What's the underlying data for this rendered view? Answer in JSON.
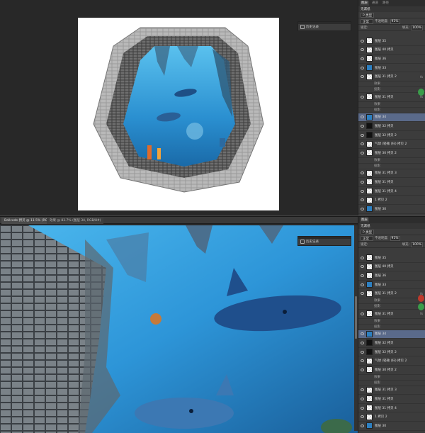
{
  "top": {
    "doc_tabs": [],
    "floating_panel_label": "历史记录",
    "layers_panel": {
      "tabs": [
        "图层",
        "通道",
        "路径"
      ],
      "subtitle": "无漏纸",
      "mode": "正常",
      "kind_filter": "P 类型",
      "opacity_label": "不透明度:",
      "opacity": "91%",
      "lock_label": "锁定:",
      "fill_label": "填充:",
      "fill": "100%",
      "layers": [
        {
          "name": "图层 35",
          "thumb": "checker"
        },
        {
          "name": "图层 40 拷贝",
          "thumb": "checker"
        },
        {
          "name": "图层 36",
          "thumb": "checker"
        },
        {
          "name": "图层 33",
          "thumb": "blue"
        },
        {
          "name": "图层 31 拷贝 2",
          "thumb": "checker",
          "fx": "fx"
        },
        {
          "name": "效果",
          "sub": true
        },
        {
          "name": "投影",
          "sub": true
        },
        {
          "name": "图层 31 拷贝",
          "thumb": "checker",
          "fx": "fx"
        },
        {
          "name": "效果",
          "sub": true
        },
        {
          "name": "投影",
          "sub": true
        },
        {
          "name": "图层 34",
          "thumb": "blue",
          "selected": true
        },
        {
          "name": "图层 32 拷贝",
          "thumb": "black"
        },
        {
          "name": "图层 32 拷贝 2",
          "thumb": "black"
        },
        {
          "name": "气球 (轻微 (扫) 拷贝 2",
          "thumb": "checker"
        },
        {
          "name": "图层 30 拷贝 2",
          "thumb": "checker"
        },
        {
          "name": "效果",
          "sub": true
        },
        {
          "name": "投影",
          "sub": true
        },
        {
          "name": "图层 31 拷贝 3",
          "thumb": "checker"
        },
        {
          "name": "图层 31 拷贝",
          "thumb": "checker"
        },
        {
          "name": "图层 31 拷贝 4",
          "thumb": "checker"
        },
        {
          "name": "1 拷贝 2",
          "thumb": "checker"
        },
        {
          "name": "图层 30",
          "thumb": "blue"
        }
      ]
    }
  },
  "bottom": {
    "doc_tabs": [
      "Ballcode 拷贝 @ 11.5% (RGB/8#)",
      "效果 @ 83.7% (图层 34, RGB/8#)"
    ],
    "floating_panel_label": "历史记录",
    "layers_panel": {
      "tabs": [
        "图层"
      ],
      "subtitle": "无漏纸",
      "mode": "正常",
      "kind_filter": "P 类型",
      "opacity_label": "不透明度:",
      "opacity": "91%",
      "lock_label": "锁定:",
      "fill_label": "填充:",
      "fill": "100%",
      "layers": [
        {
          "name": "图层 35",
          "thumb": "checker"
        },
        {
          "name": "图层 40 拷贝",
          "thumb": "checker"
        },
        {
          "name": "图层 36",
          "thumb": "checker"
        },
        {
          "name": "图层 33",
          "thumb": "blue"
        },
        {
          "name": "图层 31 拷贝 2",
          "thumb": "checker",
          "fx": "fx"
        },
        {
          "name": "效果",
          "sub": true
        },
        {
          "name": "投影",
          "sub": true
        },
        {
          "name": "图层 31 拷贝",
          "thumb": "checker",
          "fx": "fx"
        },
        {
          "name": "效果",
          "sub": true
        },
        {
          "name": "投影",
          "sub": true
        },
        {
          "name": "图层 34",
          "thumb": "blue",
          "selected": true
        },
        {
          "name": "图层 32 拷贝",
          "thumb": "black"
        },
        {
          "name": "图层 32 拷贝 2",
          "thumb": "black"
        },
        {
          "name": "气球 (轻微 (扫) 拷贝 2",
          "thumb": "checker"
        },
        {
          "name": "图层 30 拷贝 2",
          "thumb": "checker"
        },
        {
          "name": "效果",
          "sub": true
        },
        {
          "name": "投影",
          "sub": true
        },
        {
          "name": "图层 31 拷贝 3",
          "thumb": "checker"
        },
        {
          "name": "图层 31 拷贝",
          "thumb": "checker"
        },
        {
          "name": "图层 31 拷贝 4",
          "thumb": "checker"
        },
        {
          "name": "1 拷贝 2",
          "thumb": "checker"
        },
        {
          "name": "图层 30",
          "thumb": "blue"
        }
      ]
    }
  },
  "icons": [
    "eye-icon",
    "history-icon",
    "link-icon",
    "fx-icon"
  ],
  "colors": {
    "ui_dark": "#282828",
    "panel": "#3c3c3c",
    "selected_layer": "#5a6a8a",
    "water": "#1c6ea8"
  }
}
